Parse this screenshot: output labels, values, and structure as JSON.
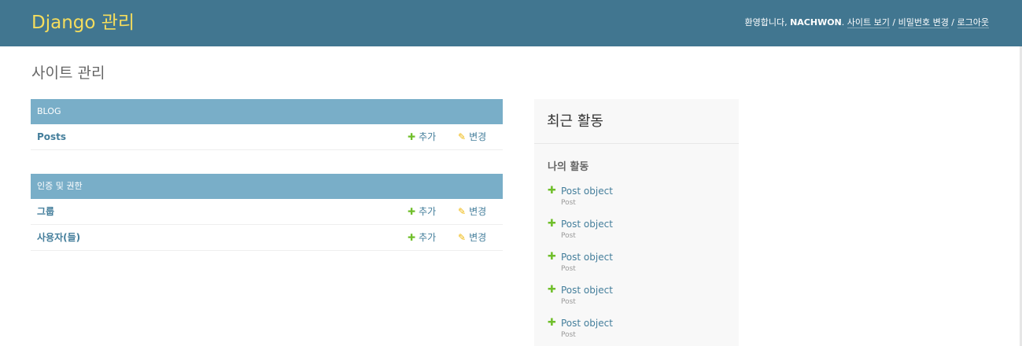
{
  "header": {
    "brand": "Django 관리",
    "welcome": "환영합니다, ",
    "username": "NACHWON",
    "period": ". ",
    "links": [
      "사이트 보기",
      "비밀번호 변경",
      "로그아웃"
    ],
    "separator": " / "
  },
  "page": {
    "title": "사이트 관리"
  },
  "apps": [
    {
      "caption": "BLOG",
      "models": [
        {
          "name": "Posts",
          "add": "추가",
          "change": "변경"
        }
      ]
    },
    {
      "caption": "인증 및 권한",
      "models": [
        {
          "name": "그룹",
          "add": "추가",
          "change": "변경"
        },
        {
          "name": "사용자(들)",
          "add": "추가",
          "change": "변경"
        }
      ]
    }
  ],
  "recent": {
    "title": "최근 활동",
    "subtitle": "나의 활동",
    "items": [
      {
        "title": "Post object",
        "type": "Post"
      },
      {
        "title": "Post object",
        "type": "Post"
      },
      {
        "title": "Post object",
        "type": "Post"
      },
      {
        "title": "Post object",
        "type": "Post"
      },
      {
        "title": "Post object",
        "type": "Post"
      }
    ]
  },
  "icons": {
    "add": "plus-icon",
    "change": "pencil-icon"
  },
  "colors": {
    "header_bg": "#417690",
    "brand": "#f5dd5d",
    "caption_bg": "#79aec8",
    "link": "#447e9b",
    "add": "#70bf2b",
    "change": "#efb80b"
  }
}
